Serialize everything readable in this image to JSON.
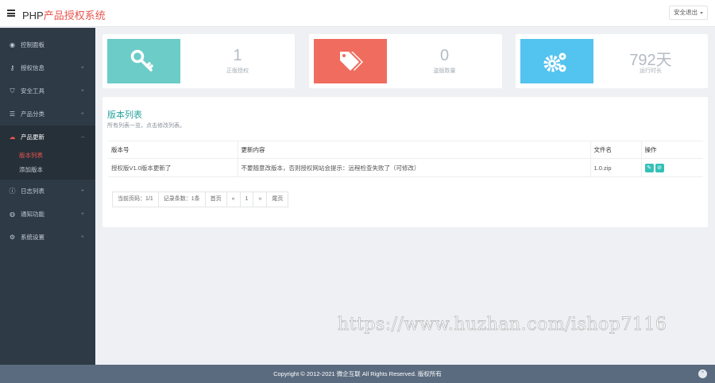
{
  "header": {
    "brand_prefix": "PHP",
    "brand_suffix": "产品授权系统",
    "logout_label": "安全退出"
  },
  "sidebar": {
    "items": [
      {
        "label": "控制面板",
        "icon": "dashboard-icon"
      },
      {
        "label": "授权信息",
        "icon": "key-icon"
      },
      {
        "label": "安全工具",
        "icon": "shield-icon"
      },
      {
        "label": "产品分类",
        "icon": "list-icon"
      },
      {
        "label": "产品更新",
        "icon": "cloud-download-icon"
      },
      {
        "label": "日志列表",
        "icon": "info-icon"
      },
      {
        "label": "通知功能",
        "icon": "bell-icon"
      },
      {
        "label": "系统设置",
        "icon": "gears-icon"
      }
    ],
    "subitems": [
      {
        "label": "版本列表"
      },
      {
        "label": "添加版本"
      }
    ],
    "arrow": "+",
    "arrow_open": "–"
  },
  "stats": [
    {
      "value": "1",
      "label": "正版授权",
      "color": "#6cccc8",
      "icon": "key-icon"
    },
    {
      "value": "0",
      "label": "盗版数量",
      "color": "#f06c5f",
      "icon": "tags-icon"
    },
    {
      "value": "792天",
      "label": "运行时长",
      "color": "#53c3ef",
      "icon": "gears-icon"
    }
  ],
  "panel": {
    "title": "版本列表",
    "subtitle": "所有列表一览，点击修改列表。"
  },
  "table": {
    "headers": [
      "版本号",
      "更新内容",
      "文件名",
      "操作"
    ],
    "rows": [
      {
        "version": "授权版V1.0版本更新了",
        "content": "不要随意改版本，否则授权网站会提示：远程检查失败了（可修改）",
        "file": "1.0.zip"
      }
    ],
    "op_edit": "✎",
    "op_delete": "⊘"
  },
  "pager": {
    "current": "当前页码：1/1",
    "total": "记录条数：1条",
    "first": "首页",
    "prev": "«",
    "page": "1",
    "next": "»",
    "last": "尾页"
  },
  "footer": {
    "copyright": "Copyright © 2012-2021 微企互联 All Rights Reserved. 版权所有",
    "top_icon": "⌃"
  },
  "watermark": "https://www.huzhan.com/ishop7116"
}
